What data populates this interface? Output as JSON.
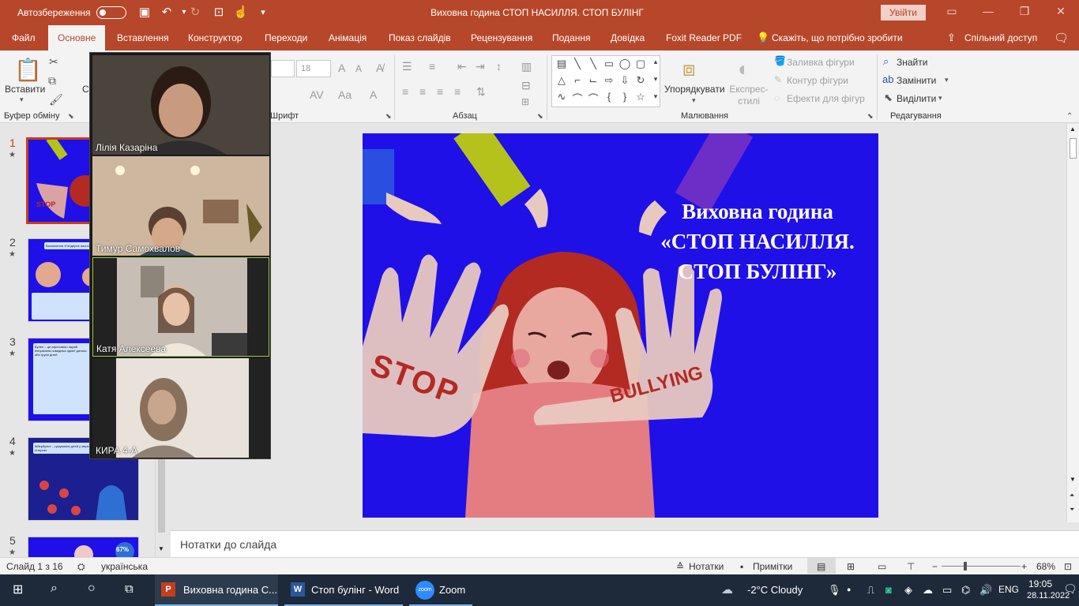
{
  "titlebar": {
    "autosave_label": "Автозбереження",
    "doc_title": "Виховна година СТОП НАСИЛЛЯ. СТОП БУЛІНГ",
    "signin_label": "Увійти",
    "icons": [
      "save-icon",
      "undo-icon",
      "redo-icon",
      "present-icon",
      "touch-mode-icon",
      "customize-icon"
    ]
  },
  "tabs": {
    "items": [
      "Файл",
      "Основне",
      "Вставлення",
      "Конструктор",
      "Переходи",
      "Анімація",
      "Показ слайдів",
      "Рецензування",
      "Подання",
      "Довідка",
      "Foxit Reader PDF",
      "Скажіть, що потрібно зробити"
    ],
    "share_label": "Спільний доступ",
    "active": "Основне"
  },
  "ribbon": {
    "clipboard": {
      "paste_label": "Вставити",
      "group_label": "Буфер обміну",
      "new_slide_short": "Ст"
    },
    "font": {
      "group_label": "Шрифт",
      "size_value": "18"
    },
    "paragraph": {
      "group_label": "Абзац"
    },
    "drawing": {
      "arrange_label": "Упорядкувати",
      "quick_styles_label": "Експрес-стилі",
      "fill_label": "Заливка фігури",
      "outline_label": "Контур фігури",
      "effects_label": "Ефекти для фігур",
      "group_label": "Малювання"
    },
    "editing": {
      "find_label": "Знайти",
      "replace_label": "Замінити",
      "select_label": "Виділити",
      "group_label": "Редагування"
    }
  },
  "thumbnails": [
    {
      "num": "1",
      "title": ""
    },
    {
      "num": "2",
      "title": "Визначення «Гендерне насильство»"
    },
    {
      "num": "3",
      "title": "Булінг – це агресивна і вкрай неприємна поведінка однієї дитини або групи дітей"
    },
    {
      "num": "4",
      "title": "Кібербулінг – цькування дітей у мережі Інтернет"
    },
    {
      "num": "5",
      "title": "67%"
    }
  ],
  "slide": {
    "title_line1": "Виховна година",
    "title_line2": "«СТОП НАСИЛЛЯ.",
    "title_line3": "СТОП БУЛІНГ»",
    "stop_text": "STOP",
    "bullying_text": "BULLYING",
    "bg_color": "#1f10e8"
  },
  "notes": {
    "placeholder": "Нотатки до слайда"
  },
  "statusbar": {
    "slide_counter": "Слайд 1 з 16",
    "language": "українська",
    "notes_label": "Нотатки",
    "comments_label": "Примітки",
    "zoom_level": "68%"
  },
  "zoom": {
    "participants": [
      "Лілія Казаріна",
      "Тимур Самохвалов",
      "Катя Алексеева",
      "КИРА 4-А"
    ]
  },
  "taskbar": {
    "apps": [
      "Виховна година С...",
      "Стоп булінг - Word",
      "Zoom"
    ],
    "weather": "-2°C  Cloudy",
    "lang": "ENG",
    "time": "19:05",
    "date": "28.11.2022"
  }
}
